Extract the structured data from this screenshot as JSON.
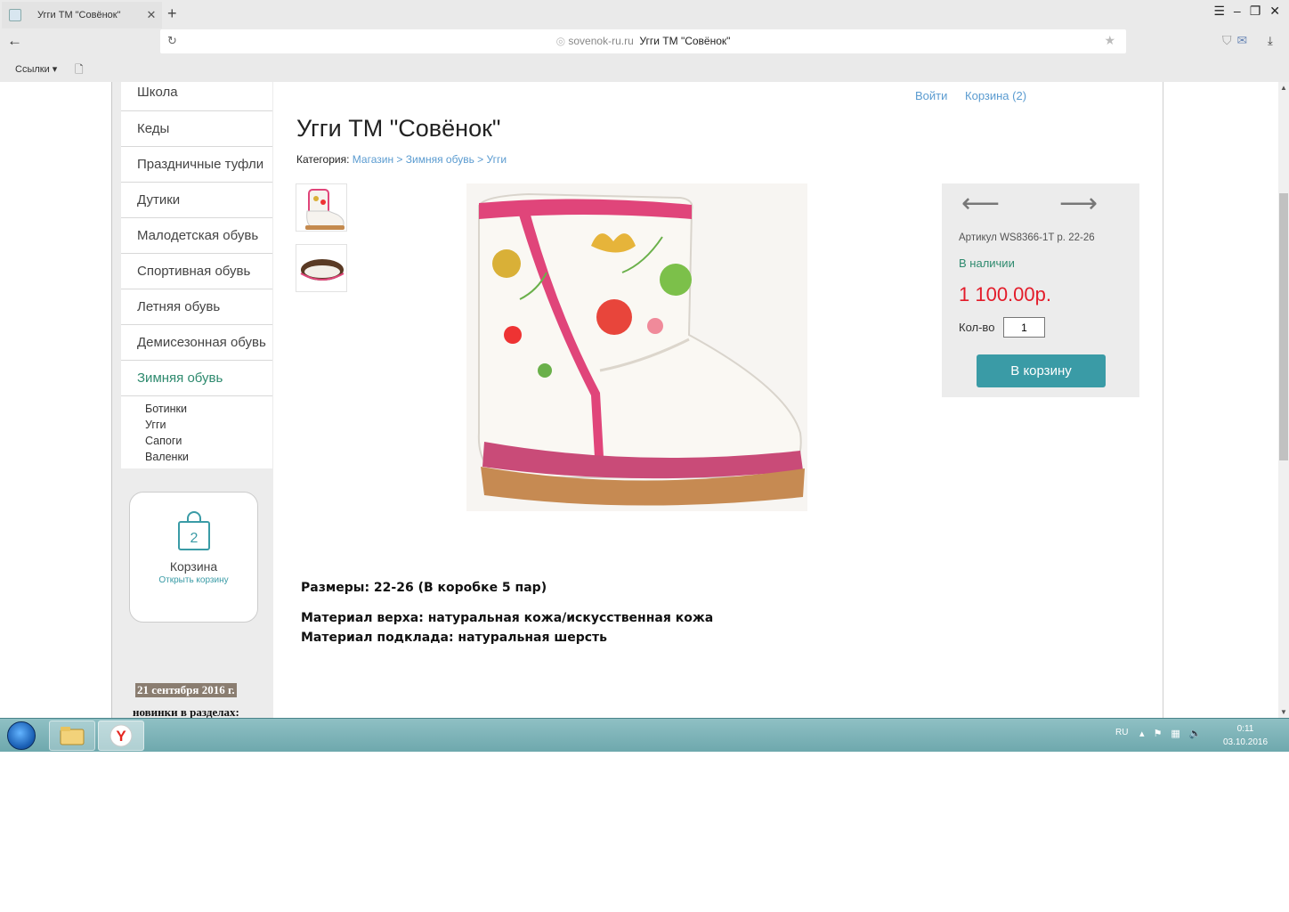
{
  "browser": {
    "tab_title": "Угги ТМ \"Совёнок\"",
    "tab_close": "✕",
    "new_tab": "+",
    "back": "←",
    "url_domain": "sovenok-ru.ru",
    "url_title": "Угги ТМ \"Совёнок\"",
    "bookmarks_links": "Ссылки ▾",
    "window_controls": [
      "☰",
      "–",
      "❐",
      "✕"
    ]
  },
  "sidebar": {
    "menu": [
      "Школа",
      "Кеды",
      "Праздничные туфли",
      "Дутики",
      "Малодетская обувь",
      "Спортивная обувь",
      "Летняя обувь",
      "Демисезонная обувь",
      "Зимняя обувь"
    ],
    "active_item": "Зимняя обувь",
    "submenu": [
      "Ботинки",
      "Угги",
      "Сапоги",
      "Валенки"
    ],
    "cart": {
      "count": "2",
      "title": "Корзина",
      "open_link": "Открыть корзину"
    },
    "news": {
      "date": "21 сентября 2016 г.",
      "heading": "новинки в разделах:"
    }
  },
  "header": {
    "login": "Войти",
    "cart_link": "Корзина (2)"
  },
  "product": {
    "title": "Угги ТМ \"Совёнок\"",
    "breadcrumb": {
      "label": "Категория:",
      "items": [
        "Магазин",
        "Зимняя обувь",
        "Угги"
      ],
      "separator": " > "
    },
    "sku": "Артикул WS8366-1T р. 22-26",
    "stock": "В наличии",
    "price": "1 100.00р.",
    "qty_label": "Кол-во",
    "qty_value": "1",
    "add_to_cart": "В корзину",
    "description": [
      "Размеры: 22-26 (В коробке 5 пар)",
      "Материал верха: натуральная кожа/искусственная кожа",
      "Материал подклада: натуральная шерсть"
    ]
  },
  "taskbar": {
    "lang": "RU",
    "time": "0:11",
    "date": "03.10.2016"
  },
  "colors": {
    "accent": "#3a9ba6",
    "price": "#e31c2a",
    "stock": "#2e8a6e",
    "link": "#5a9bd0",
    "taskbar": "#6ea8ad"
  }
}
